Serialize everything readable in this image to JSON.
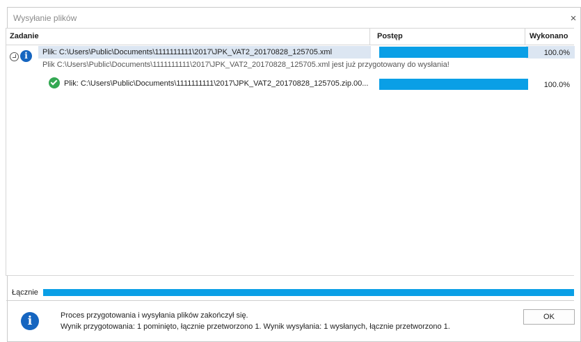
{
  "window": {
    "title": "Wysyłanie plików",
    "close_glyph": "×"
  },
  "columns": {
    "task": "Zadanie",
    "progress": "Postęp",
    "done": "Wykonano"
  },
  "rows": [
    {
      "icon": "info-icon",
      "path": "Plik: C:\\Users\\Public\\Documents\\1111111111\\2017\\JPK_VAT2_20170828_125705.xml",
      "progress": 1.0,
      "done": "100.0%",
      "message": "Plik C:\\Users\\Public\\Documents\\1111111111\\2017\\JPK_VAT2_20170828_125705.xml jest już przygotowany do wysłania!"
    },
    {
      "icon": "check-icon",
      "path": "Plik: C:\\Users\\Public\\Documents\\1111111111\\2017\\JPK_VAT2_20170828_125705.zip.00...",
      "progress": 1.0,
      "done": "100.0%"
    }
  ],
  "total": {
    "label": "Łącznie",
    "progress": 1.0
  },
  "status": {
    "line1": "Proces przygotowania i wysyłania plików zakończył się.",
    "line2": "Wynik przygotowania: 1 pominięto, łącznie przetworzono 1. Wynik wysyłania: 1 wysłanych, łącznie przetworzono 1.",
    "info_glyph": "i"
  },
  "buttons": {
    "ok": "OK"
  },
  "colors": {
    "progress": "#0a9fe6",
    "info": "#1565c0",
    "success": "#34a853",
    "selection": "#dce6f2"
  }
}
